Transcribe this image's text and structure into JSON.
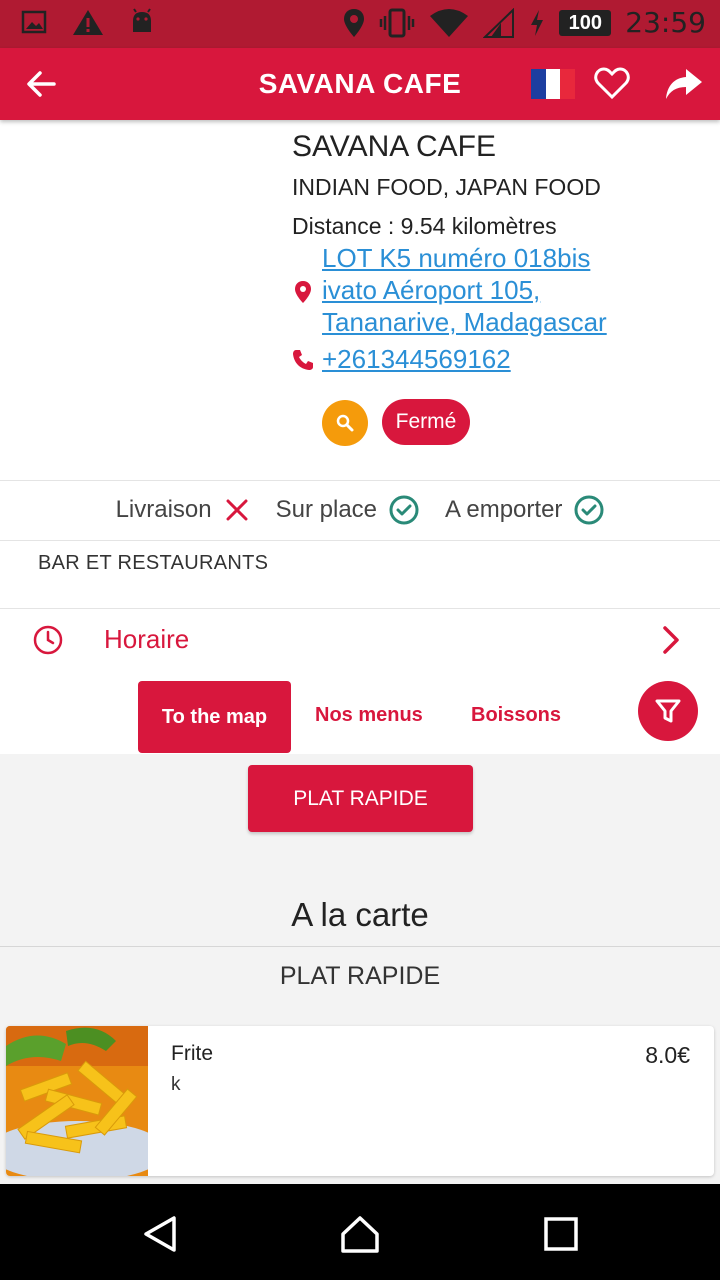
{
  "status_bar": {
    "time": "23:59",
    "battery": "100"
  },
  "app_bar": {
    "title": "SAVANA CAFE"
  },
  "restaurant": {
    "name": "SAVANA CAFE",
    "cuisine": "INDIAN FOOD, JAPAN FOOD",
    "distance": "Distance : 9.54 kilomètres",
    "address_line1": "LOT K5 numéro 018bis",
    "address_line2": "ivato Aéroport 105,",
    "address_line3": "Tananarive, Madagascar",
    "phone": "+261344569162",
    "status_label": "Fermé"
  },
  "services": [
    {
      "label": "Livraison",
      "available": false
    },
    {
      "label": "Sur place",
      "available": true
    },
    {
      "label": "A emporter",
      "available": true
    }
  ],
  "category": "BAR ET RESTAURANTS",
  "hours": {
    "label": "Horaire"
  },
  "tabs": {
    "map": "To the map",
    "menus": "Nos menus",
    "drinks": "Boissons"
  },
  "menu": {
    "filter_button": "PLAT RAPIDE",
    "section_title": "A la carte",
    "section_sub": "PLAT RAPIDE",
    "items": [
      {
        "name": "Frite",
        "description": "k",
        "price": "8.0€"
      }
    ]
  },
  "colors": {
    "primary": "#d8173d",
    "status_bar": "#b01a32",
    "link": "#2a8fd6",
    "search_button": "#f59b0b",
    "check": "#2a8a78"
  },
  "icons": [
    "back-arrow-icon",
    "france-flag-icon",
    "heart-icon",
    "share-icon",
    "location-pin-icon",
    "phone-icon",
    "search-icon",
    "close-x-icon",
    "check-circle-icon",
    "clock-icon",
    "chevron-right-icon",
    "filter-icon"
  ]
}
